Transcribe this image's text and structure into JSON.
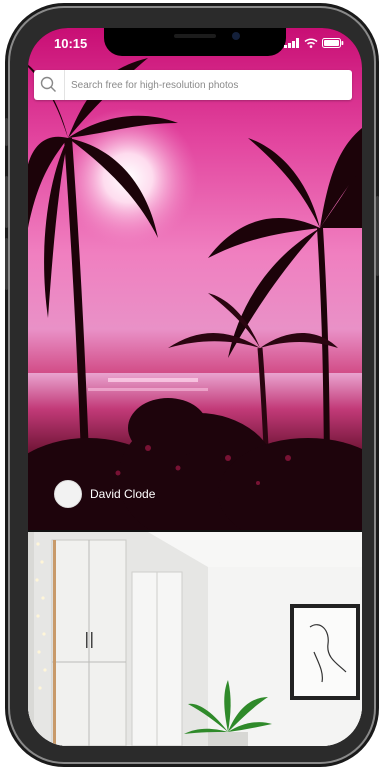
{
  "status_bar": {
    "time": "10:15"
  },
  "search": {
    "placeholder": "Search free for high-resolution photos"
  },
  "feed": {
    "items": [
      {
        "author": "David Clode"
      },
      {
        "author": ""
      }
    ]
  },
  "colors": {
    "device_frame": "#2b2b2b",
    "hero_pink": "#e2449e",
    "search_bg": "#ffffff"
  },
  "icons": [
    "search-icon",
    "signal-icon",
    "wifi-icon",
    "battery-icon"
  ]
}
